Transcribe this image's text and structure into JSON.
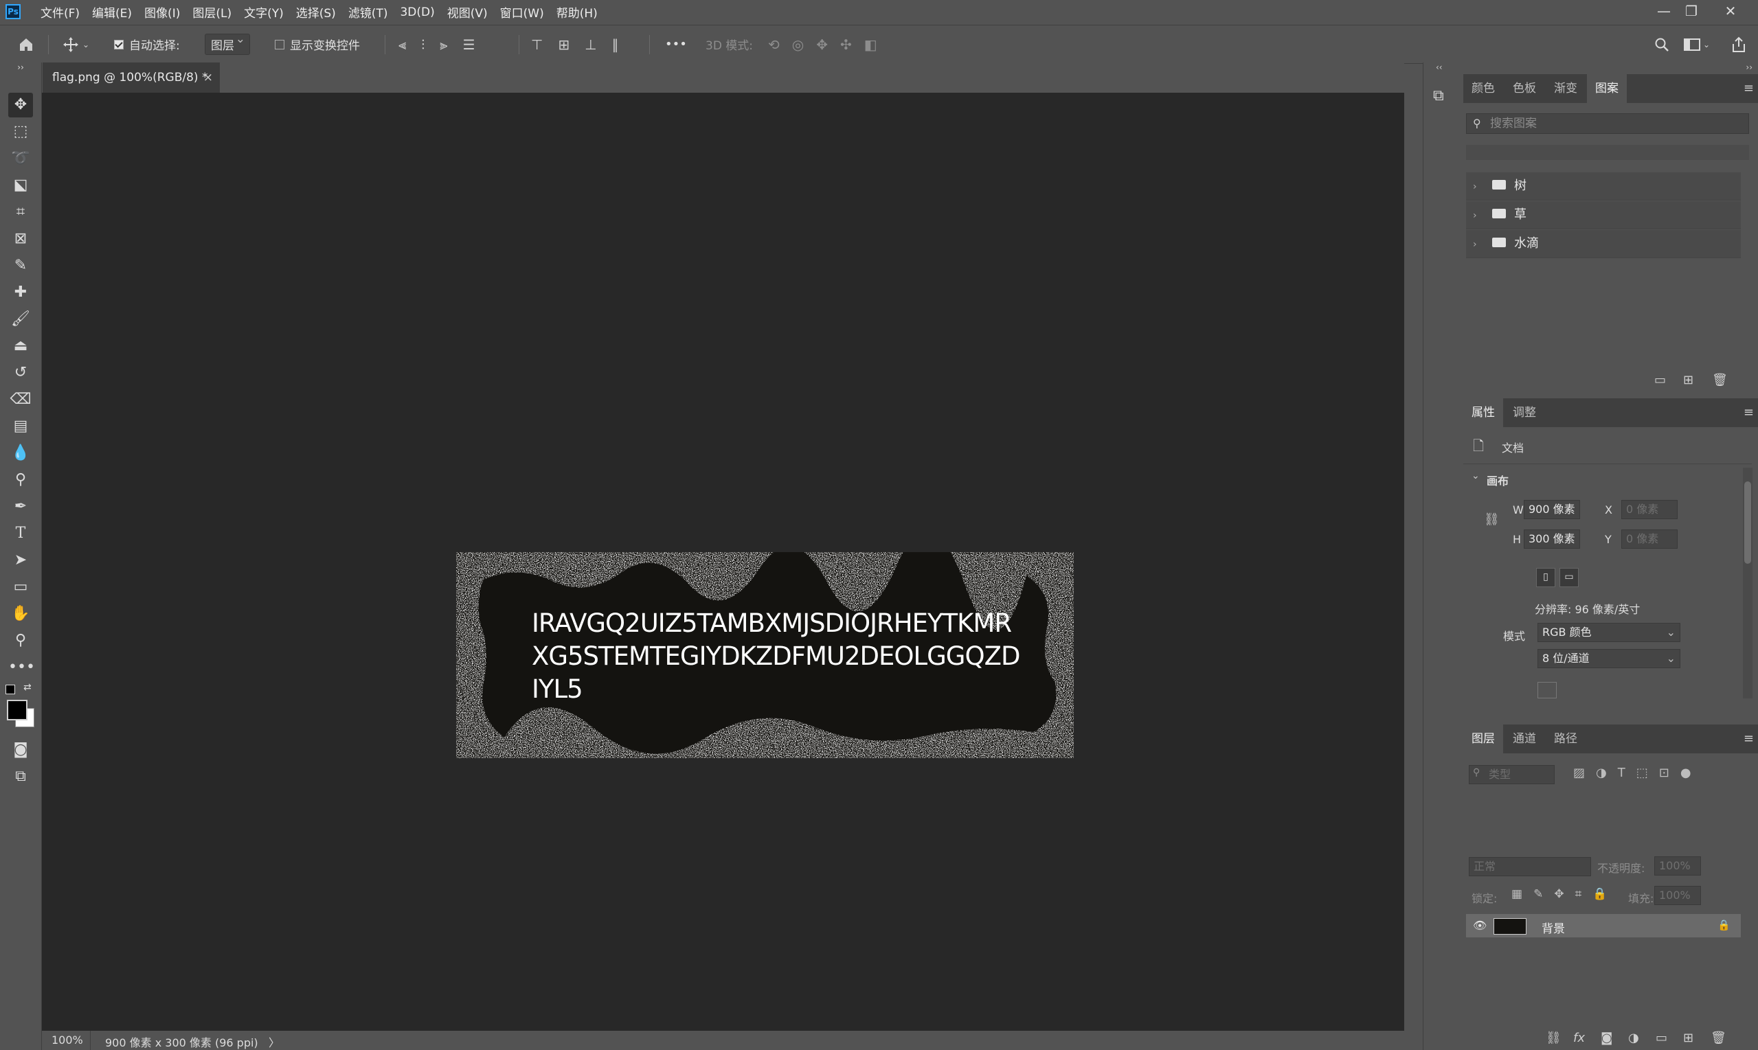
{
  "app": {
    "logo": "Ps",
    "menu": [
      "文件(F)",
      "编辑(E)",
      "图像(I)",
      "图层(L)",
      "文字(Y)",
      "选择(S)",
      "滤镜(T)",
      "3D(D)",
      "视图(V)",
      "窗口(W)",
      "帮助(H)"
    ],
    "window_controls": {
      "minimize": "—",
      "restore": "❐",
      "close": "✕"
    }
  },
  "options": {
    "auto_select_label": "自动选择:",
    "auto_select_target": "图层",
    "show_transform_label": "显示变换控件",
    "three_d_mode_label": "3D 模式:",
    "more": "•••"
  },
  "document": {
    "tab_title": "flag.png @ 100%(RGB/8) *",
    "tab_close": "×",
    "flag_text": "IRAVGQ2UIZ5TAMBXMJSDIOJRHEYTKMRXG5STEMTEGIYDKZDFMU2DEOLGGQZDIYL5",
    "zoom": "100%",
    "doc_info": "900 像素 x 300 像素 (96 ppi)",
    "status_arrow": "〉",
    "canvas_bg": "#141310"
  },
  "patterns_panel": {
    "tabs": [
      "颜色",
      "色板",
      "渐变",
      "图案"
    ],
    "active_tab": "图案",
    "search_placeholder": "搜索图案",
    "groups": [
      "树",
      "草",
      "水滴"
    ]
  },
  "properties_panel": {
    "tabs": [
      "属性",
      "调整"
    ],
    "doc_label": "文档",
    "canvas_section": "画布",
    "w_label": "W",
    "w_value": "900 像素",
    "h_label": "H",
    "h_value": "300 像素",
    "x_label": "X",
    "x_value": "0 像素",
    "y_label": "Y",
    "y_value": "0 像素",
    "resolution": "分辨率: 96 像素/英寸",
    "mode_label": "模式",
    "mode_value": "RGB 颜色",
    "depth_value": "8 位/通道"
  },
  "layers_panel": {
    "tabs": [
      "图层",
      "通道",
      "路径"
    ],
    "filter_placeholder": "类型",
    "blend_mode": "正常",
    "opacity_label": "不透明度:",
    "opacity_value": "100%",
    "lock_label": "锁定:",
    "fill_label": "填充:",
    "fill_value": "100%",
    "layer_name": "背景"
  },
  "colors": {
    "chrome": "#535353",
    "workspace": "#282828",
    "panel_dark": "#3f3f3f",
    "accent": "#31a8ff"
  }
}
